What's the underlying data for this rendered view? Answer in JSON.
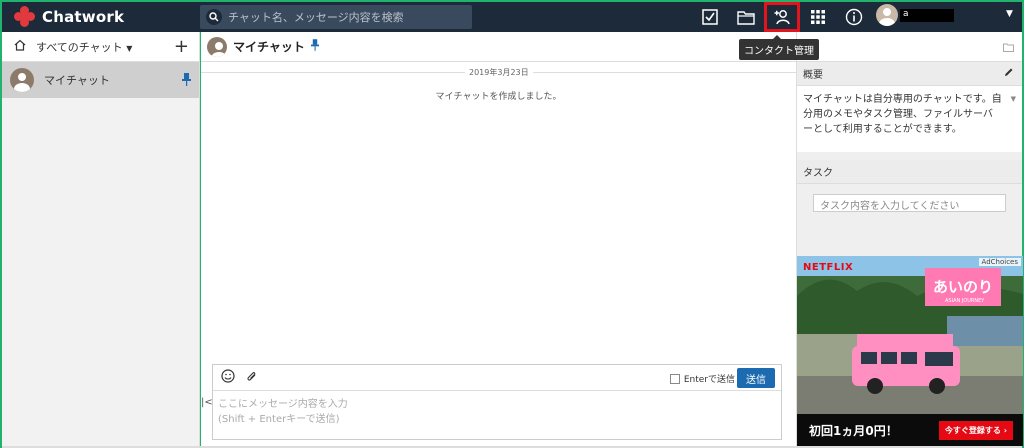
{
  "app": {
    "brand": "Chatwork"
  },
  "header": {
    "search_placeholder": "チャット名、メッセージ内容を検索",
    "user_initial": "a",
    "icons": [
      "task-check-icon",
      "folder-icon",
      "add-contact-icon",
      "apps-grid-icon",
      "info-icon"
    ],
    "tooltip": "コンタクト管理"
  },
  "sidebar": {
    "filter_label": "すべてのチャット",
    "items": [
      {
        "label": "マイチャット"
      }
    ]
  },
  "main": {
    "title": "マイチャット",
    "date_separator": "2019年3月23日",
    "system_message": "マイチャットを作成しました。",
    "composer": {
      "enter_send_label": "Enterで送信",
      "send_button": "送信",
      "placeholder_line1": "ここにメッセージ内容を入力",
      "placeholder_line2": "(Shift + Enterキーで送信)"
    }
  },
  "right_panel": {
    "overview_title": "概要",
    "overview_text": "マイチャットは自分専用のチャットです。自分用のメモやタスク管理、ファイルサーバーとして利用することができます。",
    "task_title": "タスク",
    "task_placeholder": "タスク内容を入力してください"
  },
  "ad": {
    "adchoices": "AdChoices",
    "netflix": "NETFLIX",
    "show_title": "あいのり",
    "show_subtitle": "ASIAN JOURNEY",
    "headline": "初回1ヵ月0円！",
    "cta": "今すぐ登録する ›"
  },
  "colors": {
    "header_bg": "#1c2a3a",
    "accent": "#1c6bb0",
    "highlight": "#e2141c",
    "frame": "#21b36d"
  }
}
